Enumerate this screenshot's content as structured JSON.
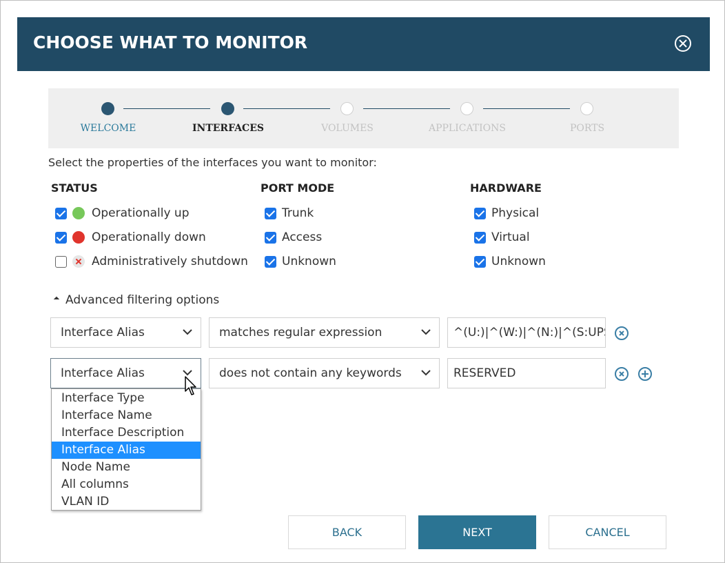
{
  "dialog": {
    "title": "CHOOSE WHAT TO MONITOR"
  },
  "stepper": {
    "steps": [
      {
        "label": "WELCOME",
        "state": "visited"
      },
      {
        "label": "INTERFACES",
        "state": "current"
      },
      {
        "label": "VOLUMES",
        "state": "future"
      },
      {
        "label": "APPLICATIONS",
        "state": "future"
      },
      {
        "label": "PORTS",
        "state": "future"
      }
    ]
  },
  "intro": "Select the properties of the interfaces you want to monitor:",
  "status": {
    "heading": "STATUS",
    "options": [
      {
        "label": "Operationally up",
        "checked": true,
        "icon": "green-status-dot"
      },
      {
        "label": "Operationally down",
        "checked": true,
        "icon": "red-status-dot"
      },
      {
        "label": "Administratively shutdown",
        "checked": false,
        "icon": "shutdown-status-icon"
      }
    ]
  },
  "port_mode": {
    "heading": "PORT MODE",
    "options": [
      {
        "label": "Trunk",
        "checked": true
      },
      {
        "label": "Access",
        "checked": true
      },
      {
        "label": "Unknown",
        "checked": true
      }
    ]
  },
  "hardware": {
    "heading": "HARDWARE",
    "options": [
      {
        "label": "Physical",
        "checked": true
      },
      {
        "label": "Virtual",
        "checked": true
      },
      {
        "label": "Unknown",
        "checked": true
      }
    ]
  },
  "advanced": {
    "label": "Advanced filtering options",
    "rules": [
      {
        "field": "Interface Alias",
        "operator": "matches regular expression",
        "value": "^(U:)|^(W:)|^(N:)|^(S:UPS"
      },
      {
        "field": "Interface Alias",
        "operator": "does not contain any keywords",
        "value": "RESERVED"
      }
    ],
    "field_options": [
      "Interface Type",
      "Interface Name",
      "Interface Description",
      "Interface Alias",
      "Node Name",
      "All columns",
      "VLAN ID"
    ],
    "selected_field": "Interface Alias"
  },
  "buttons": {
    "back": "BACK",
    "next": "NEXT",
    "cancel": "CANCEL"
  },
  "colors": {
    "header": "#204a64",
    "primary_button": "#2b7493",
    "checkbox": "#1a73e8",
    "selected_option": "#1e90ff"
  }
}
